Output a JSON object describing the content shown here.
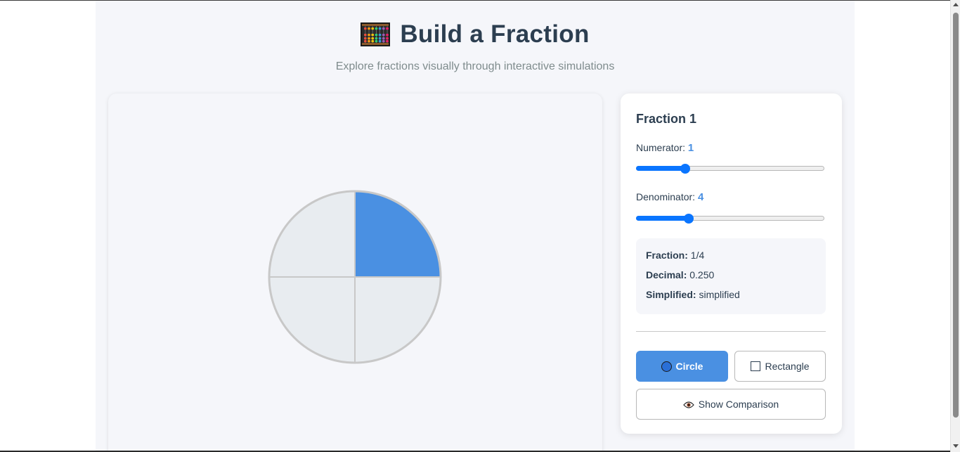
{
  "header": {
    "title": "Build a Fraction",
    "subtitle": "Explore fractions visually through interactive simulations",
    "icon": "abacus-icon"
  },
  "visual": {
    "shape": "circle",
    "numerator": 1,
    "denominator": 4,
    "filled_color": "#4a90e2",
    "empty_color": "#e8ecf0",
    "stroke_color": "#c8c8c8"
  },
  "panel": {
    "title": "Fraction 1",
    "numerator": {
      "label": "Numerator:",
      "value": "1",
      "level": 0.26
    },
    "denominator": {
      "label": "Denominator:",
      "value": "4",
      "level": 0.28
    },
    "info": {
      "fraction_label": "Fraction:",
      "fraction_value": "1/4",
      "decimal_label": "Decimal:",
      "decimal_value": "0.250",
      "simplified_label": "Simplified:",
      "simplified_value": "simplified"
    },
    "buttons": {
      "circle": "Circle",
      "rectangle": "Rectangle",
      "compare": "Show Comparison"
    }
  },
  "colors": {
    "accent": "#4a90e2",
    "slider": "#0a75ff",
    "text": "#2c3e50",
    "muted": "#7f8c8d"
  }
}
